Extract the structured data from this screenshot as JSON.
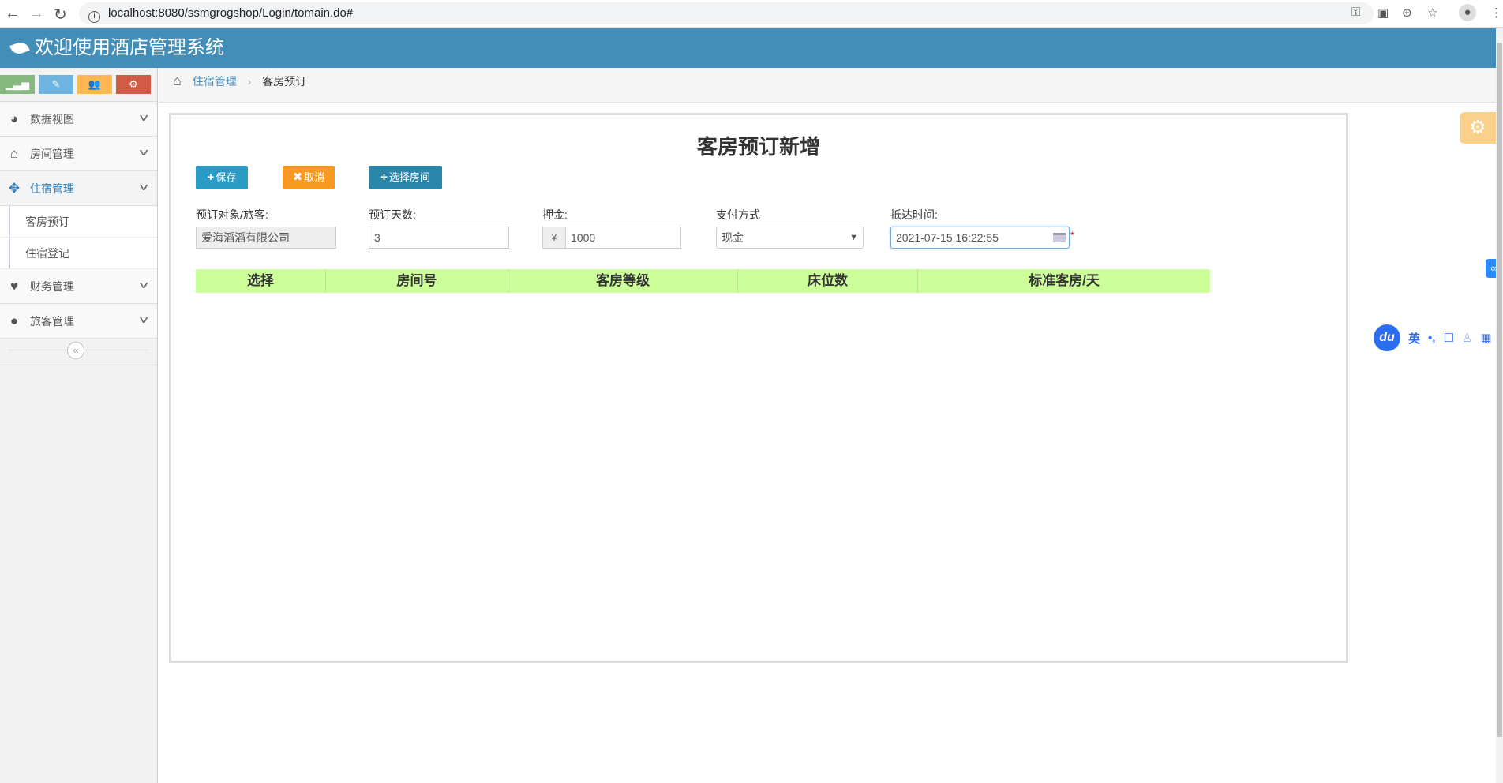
{
  "browser": {
    "url": "localhost:8080/ssmgrogshop/Login/tomain.do#"
  },
  "header": {
    "title": "欢迎使用酒店管理系统"
  },
  "sidebar": {
    "shortcuts": [
      {
        "icon": "signal-icon",
        "color": "#87b87f"
      },
      {
        "icon": "pencil-icon",
        "color": "#6fb3e0"
      },
      {
        "icon": "users-icon",
        "color": "#ffb752"
      },
      {
        "icon": "cogs-icon",
        "color": "#d15b47"
      }
    ],
    "items": [
      {
        "label": "数据视图",
        "icon": "dashboard-icon"
      },
      {
        "label": "房间管理",
        "icon": "home-icon"
      },
      {
        "label": "住宿管理",
        "icon": "move-icon",
        "active": true,
        "children": [
          {
            "label": "客房预订"
          },
          {
            "label": "住宿登记"
          }
        ]
      },
      {
        "label": "财务管理",
        "icon": "heart-icon"
      },
      {
        "label": "旅客管理",
        "icon": "user-icon"
      }
    ]
  },
  "breadcrumb": {
    "parent": "住宿管理",
    "current": "客房预订"
  },
  "form": {
    "title": "客房预订新增",
    "buttons": {
      "save": "保存",
      "cancel": "取消",
      "choose_room": "选择房间"
    },
    "fields": {
      "guest": {
        "label": "预订对象/旅客:",
        "value": "爱海滔滔有限公司"
      },
      "days": {
        "label": "预订天数:",
        "value": "3"
      },
      "deposit": {
        "label": "押金:",
        "prefix": "¥",
        "value": "1000"
      },
      "payment": {
        "label": "支付方式",
        "value": "现金"
      },
      "arrival": {
        "label": "抵达时间:",
        "value": "2021-07-15 16:22:55",
        "required_mark": "*"
      }
    },
    "table": {
      "columns": [
        "选择",
        "房间号",
        "客房等级",
        "床位数",
        "标准客房/天"
      ]
    }
  },
  "ime": {
    "logo": "du",
    "lang": "英",
    "punct": "•,"
  }
}
